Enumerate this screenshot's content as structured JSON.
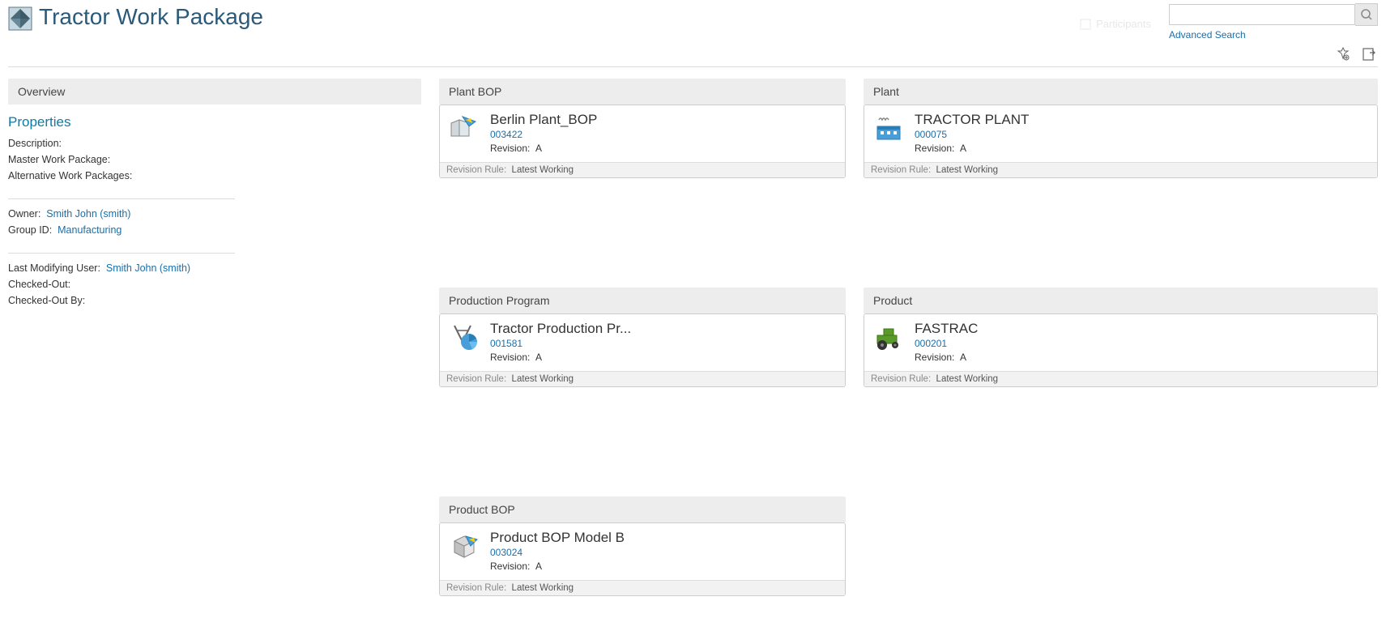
{
  "header": {
    "title": "Tractor Work Package",
    "advanced_search": "Advanced Search",
    "ghost": "Participants"
  },
  "overview": {
    "header": "Overview",
    "properties_title": "Properties",
    "description_label": "Description:",
    "description_value": "",
    "master_wp_label": "Master Work Package:",
    "master_wp_value": "",
    "alt_wp_label": "Alternative Work Packages:",
    "alt_wp_value": "",
    "owner_label": "Owner:",
    "owner_value": "Smith John (smith)",
    "group_label": "Group ID:",
    "group_value": "Manufacturing",
    "last_mod_label": "Last Modifying User:",
    "last_mod_value": "Smith John (smith)",
    "checked_out_label": "Checked-Out:",
    "checked_out_value": "",
    "checked_out_by_label": "Checked-Out By:",
    "checked_out_by_value": ""
  },
  "labels": {
    "revision": "Revision:",
    "revision_rule": "Revision Rule:"
  },
  "plant_bop": {
    "header": "Plant BOP",
    "title": "Berlin Plant_BOP",
    "id": "003422",
    "revision": "A",
    "revision_rule": "Latest Working"
  },
  "plant": {
    "header": "Plant",
    "title": "TRACTOR PLANT",
    "id": "000075",
    "revision": "A",
    "revision_rule": "Latest Working"
  },
  "production_program": {
    "header": "Production Program",
    "title": "Tractor Production Pr...",
    "id": "001581",
    "revision": "A",
    "revision_rule": "Latest Working"
  },
  "product": {
    "header": "Product",
    "title": "FASTRAC",
    "id": "000201",
    "revision": "A",
    "revision_rule": "Latest Working"
  },
  "product_bop": {
    "header": "Product BOP",
    "title": "Product BOP Model B",
    "id": "003024",
    "revision": "A",
    "revision_rule": "Latest Working"
  }
}
